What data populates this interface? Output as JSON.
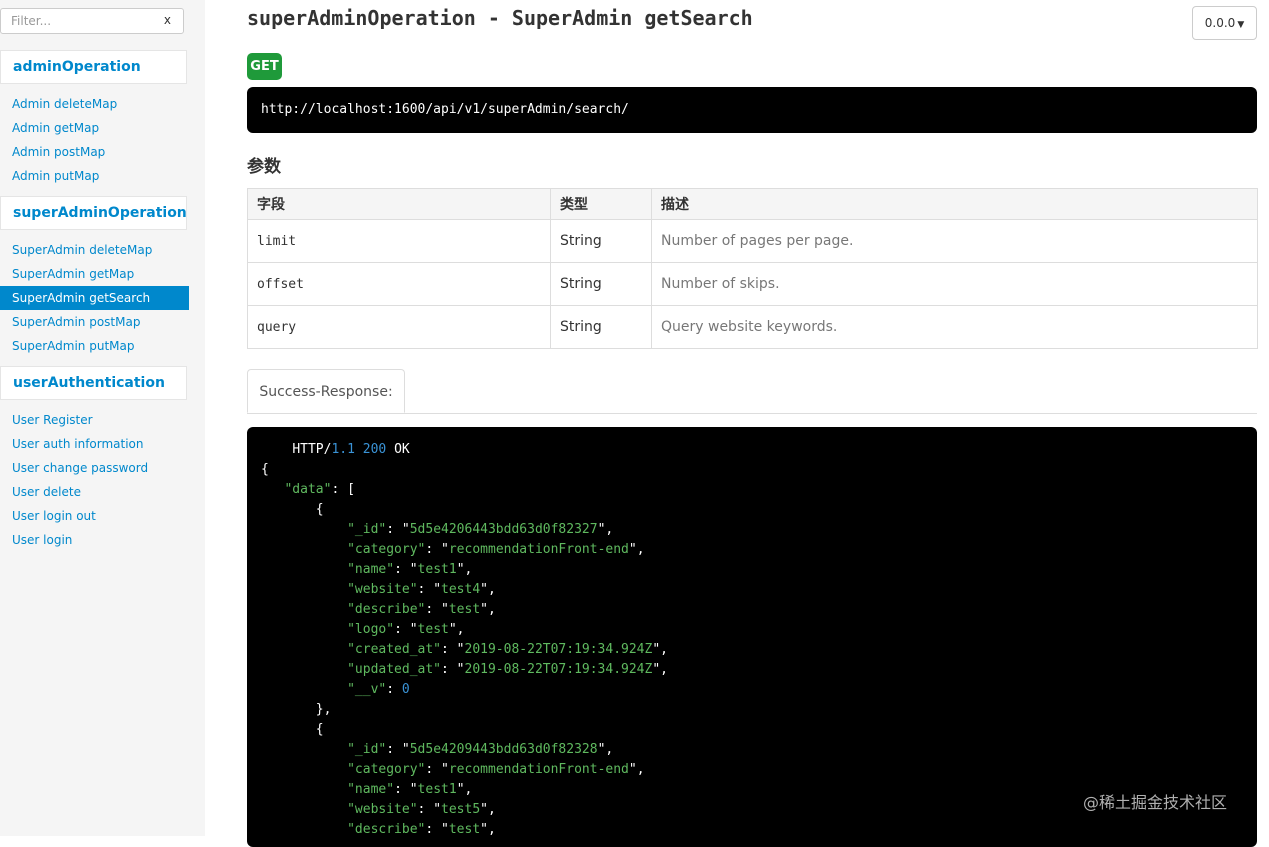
{
  "sidebar": {
    "filter_placeholder": "Filter...",
    "filter_clear": "x",
    "groups": [
      {
        "title": "adminOperation",
        "items": [
          "Admin deleteMap",
          "Admin getMap",
          "Admin postMap",
          "Admin putMap"
        ]
      },
      {
        "title": "superAdminOperation",
        "items": [
          "SuperAdmin deleteMap",
          "SuperAdmin getMap",
          "SuperAdmin getSearch",
          "SuperAdmin postMap",
          "SuperAdmin putMap"
        ]
      },
      {
        "title": "userAuthentication",
        "items": [
          "User Register",
          "User auth information",
          "User change password",
          "User delete",
          "User login out",
          "User login"
        ]
      }
    ],
    "active_item": "SuperAdmin getSearch"
  },
  "main": {
    "title": "superAdminOperation - SuperAdmin getSearch",
    "version": "0.0.0",
    "method": "GET",
    "url": "http://localhost:1600/api/v1/superAdmin/search/",
    "params_heading": "参数",
    "table": {
      "headers": [
        "字段",
        "类型",
        "描述"
      ],
      "rows": [
        {
          "field": "limit",
          "type": "String",
          "desc": "Number of pages per page."
        },
        {
          "field": "offset",
          "type": "String",
          "desc": "Number of skips."
        },
        {
          "field": "query",
          "type": "String",
          "desc": "Query website keywords."
        }
      ]
    },
    "response_tab": "Success-Response:",
    "code": {
      "status_line": {
        "protocol": "HTTP/",
        "version": "1.1",
        "code": "200",
        "text": "OK"
      },
      "items": [
        {
          "_id": "5d5e4206443bdd63d0f82327",
          "category": "recommendationFront-end",
          "name": "test1",
          "website": "test4",
          "describe": "test",
          "logo": "test",
          "created_at": "2019-08-22T07:19:34.924Z",
          "updated_at": "2019-08-22T07:19:34.924Z",
          "__v": "0"
        },
        {
          "_id": "5d5e4209443bdd63d0f82328",
          "category": "recommendationFront-end",
          "name": "test1",
          "website": "test5",
          "describe": "test"
        }
      ]
    }
  },
  "watermark": "@稀土掘金技术社区",
  "colors": {
    "accent": "#0088cc",
    "method_get": "#1f9a3a",
    "code_bg": "#000000",
    "string": "#5fb95f",
    "number": "#3a93d6"
  }
}
